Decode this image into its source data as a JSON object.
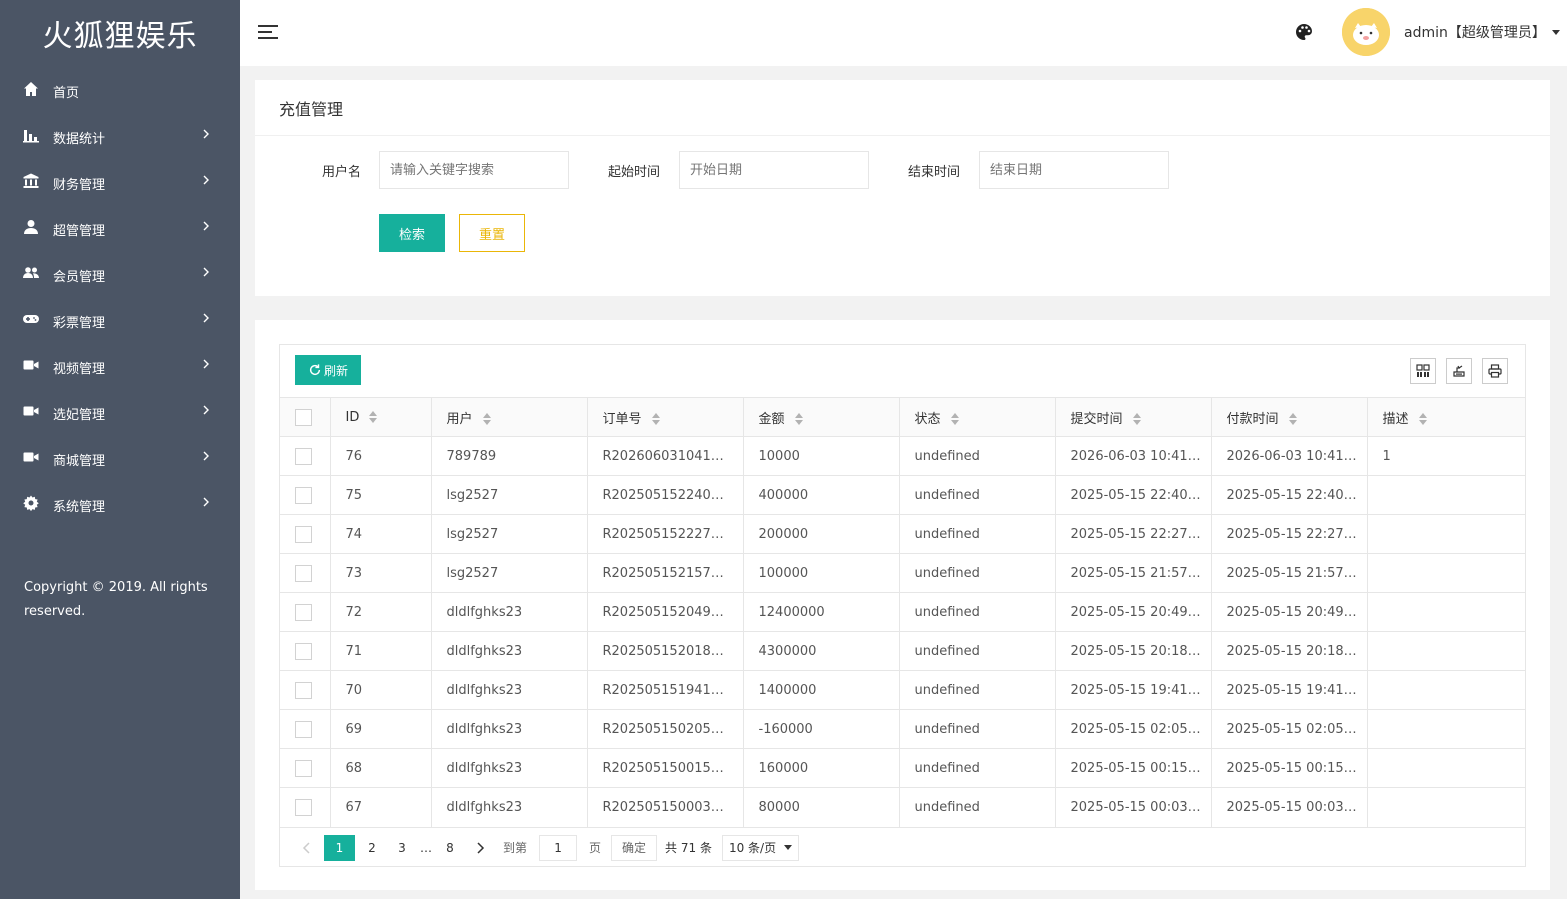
{
  "app": {
    "logo_text": "火狐狸娱乐"
  },
  "sidebar": {
    "items": [
      {
        "label": "首页",
        "icon": "home-icon",
        "has_arrow": false
      },
      {
        "label": "数据统计",
        "icon": "bar-chart-icon",
        "has_arrow": true
      },
      {
        "label": "财务管理",
        "icon": "bank-icon",
        "has_arrow": true
      },
      {
        "label": "超管管理",
        "icon": "user-icon",
        "has_arrow": true
      },
      {
        "label": "会员管理",
        "icon": "users-icon",
        "has_arrow": true
      },
      {
        "label": "彩票管理",
        "icon": "gamepad-icon",
        "has_arrow": true
      },
      {
        "label": "视频管理",
        "icon": "video-icon",
        "has_arrow": true
      },
      {
        "label": "选妃管理",
        "icon": "video-icon",
        "has_arrow": true
      },
      {
        "label": "商城管理",
        "icon": "video-icon",
        "has_arrow": true
      },
      {
        "label": "系统管理",
        "icon": "gear-icon",
        "has_arrow": true
      }
    ],
    "copyright": "Copyright © 2019. All rights reserved."
  },
  "header": {
    "user_name": "admin【超级管理员】"
  },
  "search": {
    "title": "充值管理",
    "username_label": "用户名",
    "username_placeholder": "请输入关键字搜索",
    "start_label": "起始时间",
    "start_placeholder": "开始日期",
    "end_label": "结束时间",
    "end_placeholder": "结束日期",
    "search_button": "检索",
    "reset_button": "重置"
  },
  "table": {
    "refresh_button": "刷新",
    "columns": [
      "ID",
      "用户",
      "订单号",
      "金额",
      "状态",
      "提交时间",
      "付款时间",
      "描述"
    ],
    "rows": [
      [
        "76",
        "789789",
        "R202606031041…",
        "10000",
        "undefined",
        "2026-06-03 10:41…",
        "2026-06-03 10:41…",
        "1"
      ],
      [
        "75",
        "lsg2527",
        "R202505152240…",
        "400000",
        "undefined",
        "2025-05-15 22:40…",
        "2025-05-15 22:40…",
        ""
      ],
      [
        "74",
        "lsg2527",
        "R202505152227…",
        "200000",
        "undefined",
        "2025-05-15 22:27…",
        "2025-05-15 22:27…",
        ""
      ],
      [
        "73",
        "lsg2527",
        "R202505152157…",
        "100000",
        "undefined",
        "2025-05-15 21:57…",
        "2025-05-15 21:57…",
        ""
      ],
      [
        "72",
        "dldlfghks23",
        "R202505152049…",
        "12400000",
        "undefined",
        "2025-05-15 20:49…",
        "2025-05-15 20:49…",
        ""
      ],
      [
        "71",
        "dldlfghks23",
        "R202505152018…",
        "4300000",
        "undefined",
        "2025-05-15 20:18…",
        "2025-05-15 20:18…",
        ""
      ],
      [
        "70",
        "dldlfghks23",
        "R202505151941…",
        "1400000",
        "undefined",
        "2025-05-15 19:41…",
        "2025-05-15 19:41…",
        ""
      ],
      [
        "69",
        "dldlfghks23",
        "R202505150205…",
        "-160000",
        "undefined",
        "2025-05-15 02:05…",
        "2025-05-15 02:05…",
        ""
      ],
      [
        "68",
        "dldlfghks23",
        "R202505150015…",
        "160000",
        "undefined",
        "2025-05-15 00:15…",
        "2025-05-15 00:15…",
        ""
      ],
      [
        "67",
        "dldlfghks23",
        "R202505150003…",
        "80000",
        "undefined",
        "2025-05-15 00:03…",
        "2025-05-15 00:03…",
        ""
      ]
    ]
  },
  "pagination": {
    "pages": [
      "1",
      "2",
      "3"
    ],
    "ellipsis": "…",
    "last_page": "8",
    "current": "1",
    "goto_label": "到第",
    "goto_value": "1",
    "page_unit": "页",
    "confirm": "确定",
    "total": "共 71 条",
    "page_size": "10 条/页"
  },
  "colors": {
    "sidebar_bg": "#4b5565",
    "accent": "#16b09c",
    "reset_border": "#eab608"
  }
}
